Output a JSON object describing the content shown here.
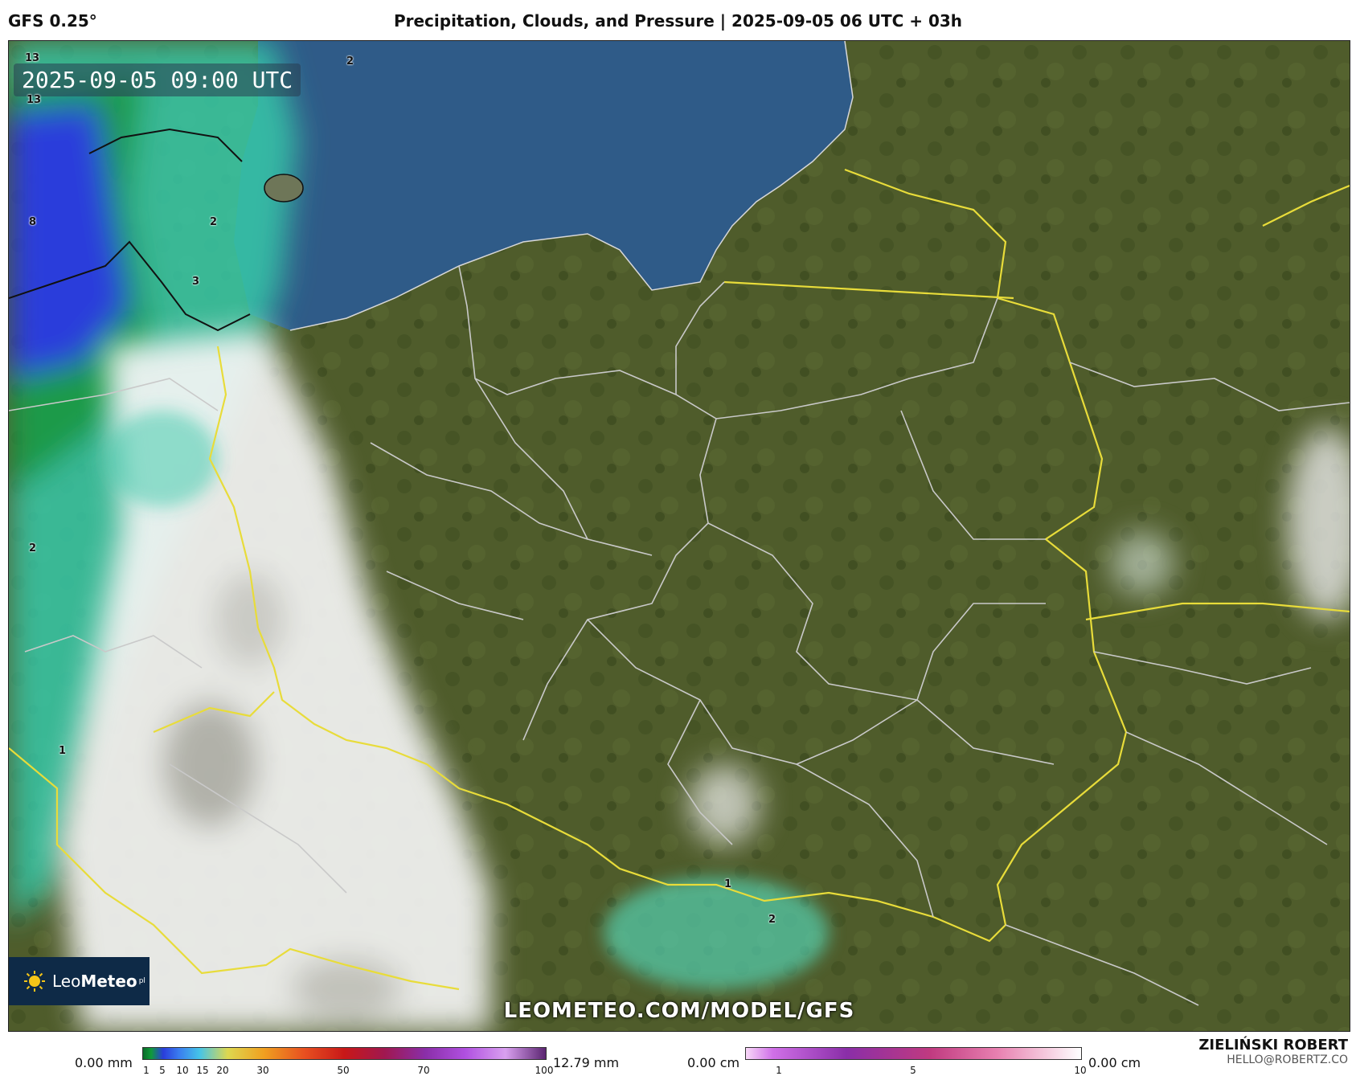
{
  "header": {
    "model": "GFS 0.25°",
    "title": "Precipitation, Clouds, and Pressure | 2025-09-05 06 UTC + 03h"
  },
  "map": {
    "valid_time": "2025-09-05 09:00 UTC",
    "watermark": "LEOMETEO.COM/MODEL/GFS",
    "logo": {
      "text_light": "Leo",
      "text_bold": "Meteo",
      "suffix": "pl"
    },
    "precip_labels": [
      {
        "text": "13"
      },
      {
        "text": "2"
      },
      {
        "text": "13"
      },
      {
        "text": "8"
      },
      {
        "text": "2"
      },
      {
        "text": "3"
      },
      {
        "text": "2"
      },
      {
        "text": "1"
      },
      {
        "text": "1"
      },
      {
        "text": "2"
      }
    ]
  },
  "legend_precip": {
    "min_label": "0.00 mm",
    "max_label": "12.79 mm",
    "ticks": [
      "1",
      "5",
      "10",
      "15",
      "20",
      "30",
      "50",
      "70",
      "100"
    ]
  },
  "legend_snow": {
    "min_label": "0.00 cm",
    "max_label": "0.00 cm",
    "ticks": [
      "1",
      "5",
      "10"
    ]
  },
  "credit": {
    "name": "ZIELIŃSKI ROBERT",
    "email": "HELLO@ROBERTZ.CO"
  },
  "colors": {
    "sea": "#2f5b88",
    "land": "#4e5b2a",
    "precip_blue": "#2a3ddb",
    "precip_green": "#1f9a4a",
    "border_yellow": "#e8dc3a"
  }
}
